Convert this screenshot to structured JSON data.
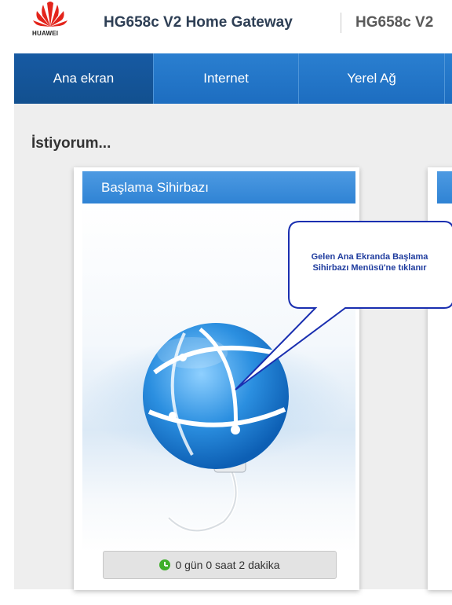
{
  "header": {
    "logo_text": "HUAWEI",
    "title": "HG658c V2 Home Gateway",
    "title_secondary": "HG658c V2"
  },
  "nav": {
    "items": [
      {
        "label": "Ana ekran",
        "active": true
      },
      {
        "label": "Internet",
        "active": false
      },
      {
        "label": "Yerel Ağ",
        "active": false
      }
    ]
  },
  "main": {
    "section_title": "İstiyorum...",
    "card": {
      "title": "Başlama Sihirbazı",
      "uptime": "0 gün 0 saat 2 dakika"
    },
    "callout": {
      "line1": "Gelen Ana Ekranda Başlama",
      "line2": "Sihirbazı Menüsü'ne tıklanır"
    }
  },
  "colors": {
    "nav_bg": "#1d6dc0",
    "card_header": "#2f83d4",
    "callout_border": "#1a2fb0"
  }
}
